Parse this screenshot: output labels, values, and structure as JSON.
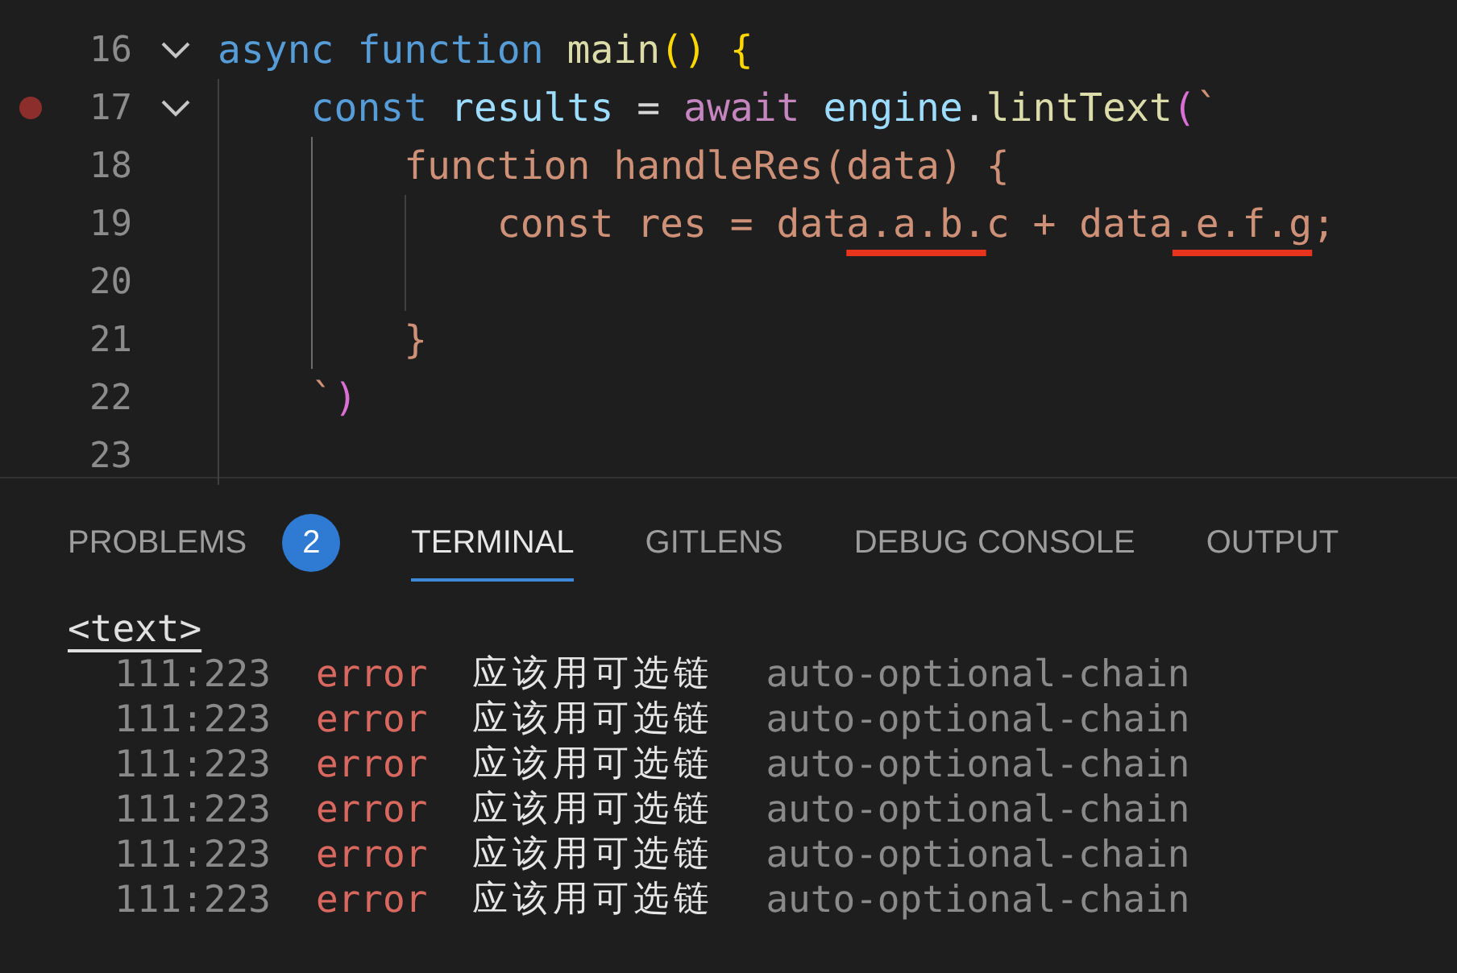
{
  "editor": {
    "lines": [
      {
        "number": "16",
        "fold": true,
        "breakpoint": false,
        "tokens": [
          {
            "text": "async",
            "kind": "keyword"
          },
          {
            "text": " function",
            "kind": "keyword"
          },
          {
            "text": " main",
            "kind": "function"
          },
          {
            "text": "()",
            "kind": "bracket1"
          },
          {
            "text": " {",
            "kind": "bracket1"
          }
        ]
      },
      {
        "number": "17",
        "fold": true,
        "breakpoint": true,
        "guides": [
          {
            "active": false
          }
        ],
        "tokens": [
          {
            "text": "    const",
            "kind": "keyword"
          },
          {
            "text": " results",
            "kind": "variable"
          },
          {
            "text": " = ",
            "kind": "plain"
          },
          {
            "text": "await",
            "kind": "control"
          },
          {
            "text": " engine",
            "kind": "variable"
          },
          {
            "text": ".",
            "kind": "plain"
          },
          {
            "text": "lintText",
            "kind": "function"
          },
          {
            "text": "(",
            "kind": "bracket2"
          },
          {
            "text": "`",
            "kind": "string"
          }
        ]
      },
      {
        "number": "18",
        "fold": false,
        "breakpoint": false,
        "guides": [
          {
            "active": false
          },
          {
            "active": true
          }
        ],
        "tokens": [
          {
            "text": "        function handleRes(data) {",
            "kind": "string"
          }
        ]
      },
      {
        "number": "19",
        "fold": false,
        "breakpoint": false,
        "guides": [
          {
            "active": false
          },
          {
            "active": true
          },
          {
            "active": false
          }
        ],
        "tokens": [
          {
            "text": "            const res = dat",
            "kind": "string"
          },
          {
            "text": "a.a.b.",
            "kind": "string",
            "error": true
          },
          {
            "text": "c + data",
            "kind": "string"
          },
          {
            "text": ".e.f.g",
            "kind": "string",
            "error": true
          },
          {
            "text": ";",
            "kind": "string"
          }
        ]
      },
      {
        "number": "20",
        "fold": false,
        "breakpoint": false,
        "guides": [
          {
            "active": false
          },
          {
            "active": true
          },
          {
            "active": false
          }
        ]
      },
      {
        "number": "21",
        "fold": false,
        "breakpoint": false,
        "guides": [
          {
            "active": false
          },
          {
            "active": true
          }
        ],
        "tokens": [
          {
            "text": "        }",
            "kind": "string"
          }
        ]
      },
      {
        "number": "22",
        "fold": false,
        "breakpoint": false,
        "guides": [
          {
            "active": false
          }
        ],
        "tokens": [
          {
            "text": "    `",
            "kind": "string"
          },
          {
            "text": ")",
            "kind": "bracket2"
          }
        ]
      },
      {
        "number": "23",
        "fold": false,
        "breakpoint": false,
        "guides": [
          {
            "active": false
          }
        ]
      }
    ]
  },
  "panel": {
    "tabs": [
      {
        "label": "PROBLEMS",
        "selected": false,
        "badge": "2"
      },
      {
        "label": "TERMINAL",
        "selected": true
      },
      {
        "label": "GITLENS",
        "selected": false
      },
      {
        "label": "DEBUG CONSOLE",
        "selected": false
      },
      {
        "label": "OUTPUT",
        "selected": false
      }
    ],
    "terminal": {
      "file": "<text>",
      "rows": [
        {
          "position": "111:223",
          "severity": "error",
          "message": "应该用可选链",
          "rule": "auto-optional-chain"
        },
        {
          "position": "111:223",
          "severity": "error",
          "message": "应该用可选链",
          "rule": "auto-optional-chain"
        },
        {
          "position": "111:223",
          "severity": "error",
          "message": "应该用可选链",
          "rule": "auto-optional-chain"
        },
        {
          "position": "111:223",
          "severity": "error",
          "message": "应该用可选链",
          "rule": "auto-optional-chain"
        },
        {
          "position": "111:223",
          "severity": "error",
          "message": "应该用可选链",
          "rule": "auto-optional-chain"
        },
        {
          "position": "111:223",
          "severity": "error",
          "message": "应该用可选链",
          "rule": "auto-optional-chain"
        }
      ]
    }
  }
}
